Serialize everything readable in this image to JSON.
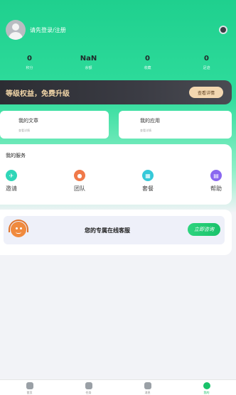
{
  "header": {
    "login_text": "请先登录/注册"
  },
  "stats": [
    {
      "value": "0",
      "label": "积分"
    },
    {
      "value": "NaN",
      "label": "余额"
    },
    {
      "value": "0",
      "label": "收藏"
    },
    {
      "value": "0",
      "label": "足迹"
    }
  ],
  "vip": {
    "text": "等级权益，免费升级",
    "button": "查看详情"
  },
  "cards": {
    "articles_title": "我的文章",
    "articles_sub": "查看详情",
    "apps_title": "我的应用",
    "apps_sub": "查看详情"
  },
  "services": {
    "title": "我的服务",
    "items": [
      {
        "label": "邀请",
        "icon": "invite-icon",
        "color": "#2fd6b8"
      },
      {
        "label": "团队",
        "icon": "team-icon",
        "color": "#f07a4a"
      },
      {
        "label": "套餐",
        "icon": "package-icon",
        "color": "#36c9d9"
      },
      {
        "label": "帮助",
        "icon": "help-icon",
        "color": "#8a68f0"
      }
    ]
  },
  "support": {
    "text": "您的专属在线客服",
    "button": "立即咨询"
  },
  "tabs": [
    {
      "label": "首页",
      "icon": "home-icon"
    },
    {
      "label": "任务",
      "icon": "task-icon"
    },
    {
      "label": "消息",
      "icon": "message-icon"
    },
    {
      "label": "我的",
      "icon": "profile-icon"
    }
  ],
  "colors": {
    "brand": "#1fd08e",
    "active_tab": "#19c26a"
  }
}
